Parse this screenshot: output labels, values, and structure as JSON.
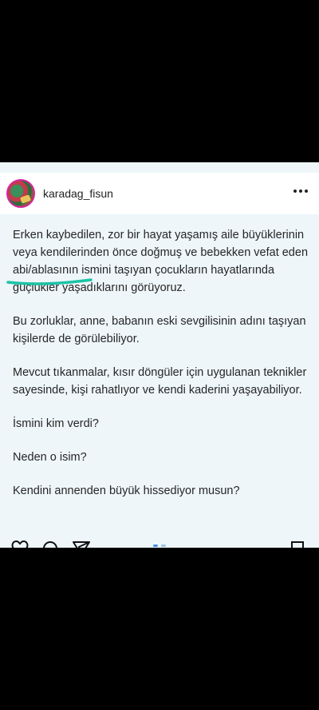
{
  "post": {
    "username": "karadag_fisun",
    "paragraphs": [
      "Erken kaybedilen, zor bir hayat yaşamış aile büyüklerinin veya kendilerinden önce doğmuş ve bebekken vefat eden abi/ablasının ismini taşıyan çocukların hayatlarında güçlükler yaşadıklarını görüyoruz.",
      "Bu zorluklar, anne, babanın eski sevgilisinin adını taşıyan kişilerde de görülebiliyor.",
      "Mevcut tıkanmalar, kısır döngüler için uygulanan teknikler sayesinde, kişi rahatlıyor ve kendi kaderini yaşayabiliyor.",
      "İsmini kim verdi?",
      "Neden o isim?",
      "Kendini annenden büyük hissediyor musun?"
    ],
    "highlight_color": "#1bc3a6",
    "icons": [
      "heart-icon",
      "comment-icon",
      "share-icon",
      "bookmark-icon"
    ]
  }
}
